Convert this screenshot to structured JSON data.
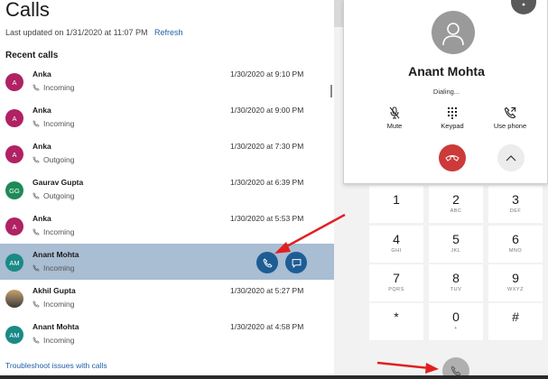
{
  "header": {
    "title": "Calls",
    "last_updated": "Last updated on 1/31/2020 at 11:07 PM",
    "refresh_label": "Refresh",
    "recent_heading": "Recent calls"
  },
  "calls": [
    {
      "initials": "A",
      "name": "Anka",
      "direction": "Incoming",
      "time": "1/30/2020 at 9:10 PM",
      "avatar_color": "#b02263"
    },
    {
      "initials": "A",
      "name": "Anka",
      "direction": "Incoming",
      "time": "1/30/2020 at 9:00 PM",
      "avatar_color": "#b02263"
    },
    {
      "initials": "A",
      "name": "Anka",
      "direction": "Outgoing",
      "time": "1/30/2020 at 7:30 PM",
      "avatar_color": "#b02263"
    },
    {
      "initials": "GG",
      "name": "Gaurav Gupta",
      "direction": "Outgoing",
      "time": "1/30/2020 at 6:39 PM",
      "avatar_color": "#1e8a57"
    },
    {
      "initials": "A",
      "name": "Anka",
      "direction": "Incoming",
      "time": "1/30/2020 at 5:53 PM",
      "avatar_color": "#b02263"
    },
    {
      "initials": "AM",
      "name": "Anant Mohta",
      "direction": "Incoming",
      "time": "",
      "avatar_color": "#1a8a86"
    },
    {
      "initials": "",
      "name": "Akhil Gupta",
      "direction": "Incoming",
      "time": "1/30/2020 at 5:27 PM",
      "avatar_color": "photo"
    },
    {
      "initials": "AM",
      "name": "Anant Mohta",
      "direction": "Incoming",
      "time": "1/30/2020 at 4:58 PM",
      "avatar_color": "#1a8a86"
    }
  ],
  "footer": {
    "troubleshoot_label": "Troubleshoot issues with calls"
  },
  "call_window": {
    "name": "Anant Mohta",
    "status": "Dialing...",
    "mute_label": "Mute",
    "keypad_label": "Keypad",
    "use_phone_label": "Use phone"
  },
  "dialpad": {
    "keys": [
      {
        "digit": "1",
        "letters": ""
      },
      {
        "digit": "2",
        "letters": "ABC"
      },
      {
        "digit": "3",
        "letters": "DEF"
      },
      {
        "digit": "4",
        "letters": "GHI"
      },
      {
        "digit": "5",
        "letters": "JKL"
      },
      {
        "digit": "6",
        "letters": "MNO"
      },
      {
        "digit": "7",
        "letters": "PQRS"
      },
      {
        "digit": "8",
        "letters": "TUV"
      },
      {
        "digit": "9",
        "letters": "WXYZ"
      },
      {
        "digit": "*",
        "letters": ""
      },
      {
        "digit": "0",
        "letters": "+"
      },
      {
        "digit": "#",
        "letters": ""
      }
    ]
  },
  "colors": {
    "accent": "#1e5d94",
    "selected_row": "#a9bdd3",
    "hangup": "#cc3a3a",
    "annotation_arrow": "#e02020"
  },
  "icons": {
    "row_direction": "phone-arrow-icon",
    "call_action": "phone-icon",
    "message_action": "chat-icon",
    "mute": "mic-off-icon",
    "keypad": "keypad-icon",
    "use_phone": "phone-transfer-icon",
    "hangup": "hangup-icon",
    "collapse": "chevron-up-icon",
    "more": "more-vertical-icon",
    "dial": "phone-icon"
  }
}
